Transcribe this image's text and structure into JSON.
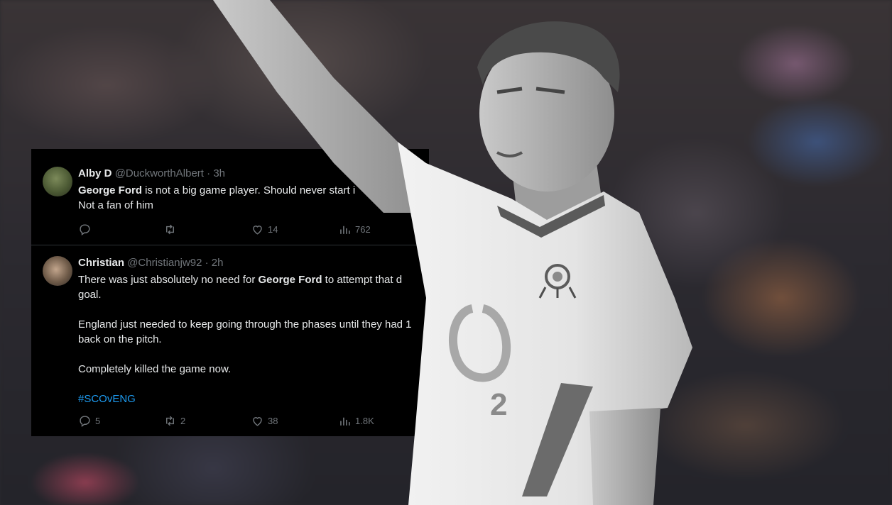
{
  "tweets": [
    {
      "name": "Alby D",
      "handle": "@DuckworthAlbert",
      "time": "3h",
      "body": [
        {
          "bold": "George Ford",
          "text": " is not a big game player. Should never start i"
        },
        {
          "bold": "",
          "text": "Not a fan of him"
        }
      ],
      "replies": "",
      "retweets": "",
      "likes": "14",
      "views": "762"
    },
    {
      "name": "Christian",
      "handle": "@Christianjw92",
      "time": "2h",
      "body": [
        {
          "pre": "There was just absolutely no need for ",
          "bold": "George Ford",
          "text": " to attempt that d"
        },
        {
          "pre": "goal.",
          "bold": "",
          "text": ""
        },
        {
          "pre": "",
          "bold": "",
          "text": ""
        },
        {
          "pre": "England just needed to keep going through the phases until they had 1",
          "bold": "",
          "text": ""
        },
        {
          "pre": "back on the pitch.",
          "bold": "",
          "text": ""
        },
        {
          "pre": "",
          "bold": "",
          "text": ""
        },
        {
          "pre": "Completely killed the game now.",
          "bold": "",
          "text": ""
        },
        {
          "pre": "",
          "bold": "",
          "text": ""
        }
      ],
      "hashtag": "#SCOvENG",
      "replies": "5",
      "retweets": "2",
      "likes": "38",
      "views": "1.8K"
    }
  ],
  "icons": {
    "reply": "reply-icon",
    "retweet": "retweet-icon",
    "like": "heart-icon",
    "views": "views-icon"
  },
  "jersey": {
    "number": "2",
    "sponsor": "O2",
    "crest": "rose-icon"
  },
  "colors": {
    "card_bg": "#000000",
    "text": "#e7e9ea",
    "muted": "#71767b",
    "link": "#1d9bf0"
  }
}
